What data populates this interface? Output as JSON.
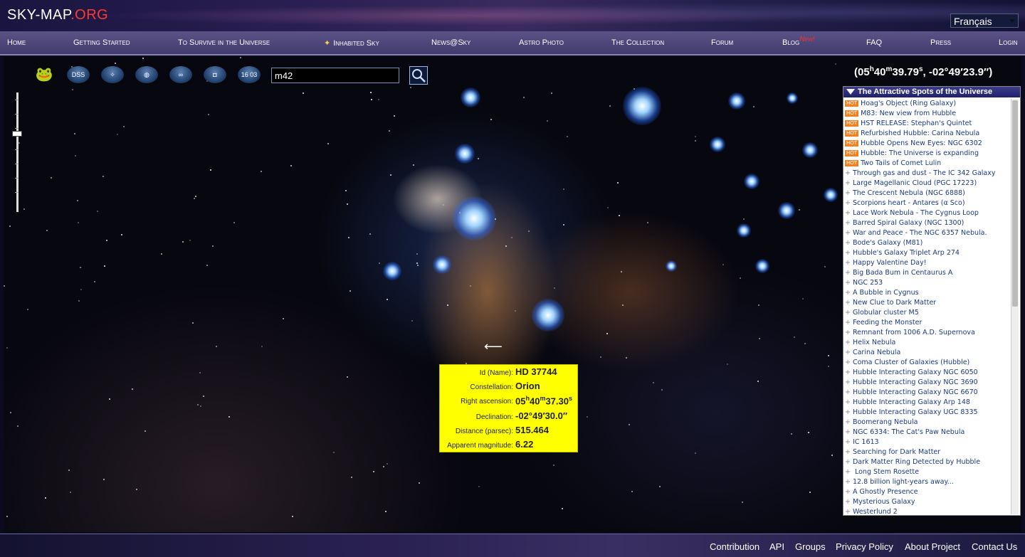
{
  "header": {
    "logo_main": "SKY-MAP",
    "logo_org": ".ORG",
    "language": "Français"
  },
  "nav": [
    {
      "label": "Home"
    },
    {
      "label": "Getting Started"
    },
    {
      "label": "To Survive in the Universe"
    },
    {
      "label": "Inhabited Sky"
    },
    {
      "label": "News@Sky"
    },
    {
      "label": "Astro Photo"
    },
    {
      "label": "The Collection"
    },
    {
      "label": "Forum"
    },
    {
      "label": "Blog"
    },
    {
      "label": "FAQ"
    },
    {
      "label": "Press"
    },
    {
      "label": "Login"
    }
  ],
  "nav_badge": "New!",
  "toolbar": {
    "dss": "DSS",
    "clock": "16 03",
    "search_value": "m42"
  },
  "icons": [
    "frog-icon",
    "dss-icon",
    "constellation-icon",
    "grid-globe-icon",
    "infinity-icon",
    "camera-icon",
    "clock-icon",
    "magnifier-icon"
  ],
  "coords": {
    "ra_h": "05",
    "ra_m": "40",
    "ra_s": "39.79",
    "dec": "-02°49′23.9″"
  },
  "panel": {
    "title": "The Attractive Spots of the Universe",
    "hot_label": "HOT",
    "items": [
      {
        "label": "Hoag's Object (Ring Galaxy)",
        "hot": true
      },
      {
        "label": "M83: New view from Hubble",
        "hot": true
      },
      {
        "label": "HST RELEASE: Stephan's Quintet",
        "hot": true
      },
      {
        "label": "Refurbished Hubble: Carina Nebula",
        "hot": true
      },
      {
        "label": "Hubble Opens New Eyes: NGC 6302",
        "hot": true
      },
      {
        "label": "Hubble: The Universe is expanding",
        "hot": true
      },
      {
        "label": "Two Tails of Comet Lulin",
        "hot": true
      },
      {
        "label": "Through gas and dust - The IC 342 Galaxy",
        "hot": false
      },
      {
        "label": "Large Magellanic Cloud (PGC 17223)",
        "hot": false
      },
      {
        "label": "The Crescent Nebula (NGC 6888)",
        "hot": false
      },
      {
        "label": "Scorpions heart - Antares (α Sco)",
        "hot": false
      },
      {
        "label": "Lace Work Nebula - The Cygnus Loop",
        "hot": false
      },
      {
        "label": "Barred Spiral Galaxy (NGC 1300)",
        "hot": false
      },
      {
        "label": "War and Peace - The NGC 6357 Nebula.",
        "hot": false
      },
      {
        "label": "Bode's Galaxy (M81)",
        "hot": false
      },
      {
        "label": "Hubble's Galaxy Triplet Arp 274",
        "hot": false
      },
      {
        "label": "Happy Valentine Day!",
        "hot": false
      },
      {
        "label": "Big Bada Bum in Centaurus A",
        "hot": false
      },
      {
        "label": "NGC 253",
        "hot": false
      },
      {
        "label": "A Bubble in Cygnus",
        "hot": false
      },
      {
        "label": "New Clue to Dark Matter",
        "hot": false
      },
      {
        "label": "Globular cluster M5",
        "hot": false
      },
      {
        "label": "Feeding the Monster",
        "hot": false
      },
      {
        "label": "Remnant from 1006 A.D. Supernova",
        "hot": false
      },
      {
        "label": "Helix Nebula",
        "hot": false
      },
      {
        "label": "Carina Nebula",
        "hot": false
      },
      {
        "label": "Coma Cluster of Galaxies (Hubble)",
        "hot": false
      },
      {
        "label": "Hubble Interacting Galaxy NGC 6050",
        "hot": false
      },
      {
        "label": "Hubble Interacting Galaxy NGC 3690",
        "hot": false
      },
      {
        "label": "Hubble Interacting Galaxy NGC 6670",
        "hot": false
      },
      {
        "label": "Hubble Interacting Galaxy Arp 148",
        "hot": false
      },
      {
        "label": "Hubble Interacting Galaxy UGC 8335",
        "hot": false
      },
      {
        "label": "Boomerang Nebula",
        "hot": false
      },
      {
        "label": "NGC 6334: The Cat's Paw Nebula",
        "hot": false
      },
      {
        "label": "IC 1613",
        "hot": false
      },
      {
        "label": "Searching for Dark Matter",
        "hot": false
      },
      {
        "label": "Dark Matter Ring Detected by Hubble",
        "hot": false
      },
      {
        "label": " Long Stem Rosette",
        "hot": false
      },
      {
        "label": "12.8 billion light-years away...",
        "hot": false
      },
      {
        "label": "A Ghostly Presence",
        "hot": false
      },
      {
        "label": "Mysterious Galaxy",
        "hot": false
      },
      {
        "label": "Westerlund 2",
        "hot": false
      }
    ]
  },
  "popup": {
    "name_label": "Id (Name):",
    "name": "HD 37744",
    "const_label": "Constellation:",
    "const": "Orion",
    "ra_label": "Right ascension:",
    "ra_h": "05",
    "ra_m": "40",
    "ra_s": "37.30",
    "dec_label": "Declination:",
    "dec": "-02°49′30.0″",
    "dist_label": "Distance (parsec):",
    "dist": "515.464",
    "mag_label": "Apparent magnitude:",
    "mag": "6.22"
  },
  "footer": [
    "Contribution",
    "API",
    "Groups",
    "Privacy Policy",
    "About Project",
    "Contact Us"
  ]
}
